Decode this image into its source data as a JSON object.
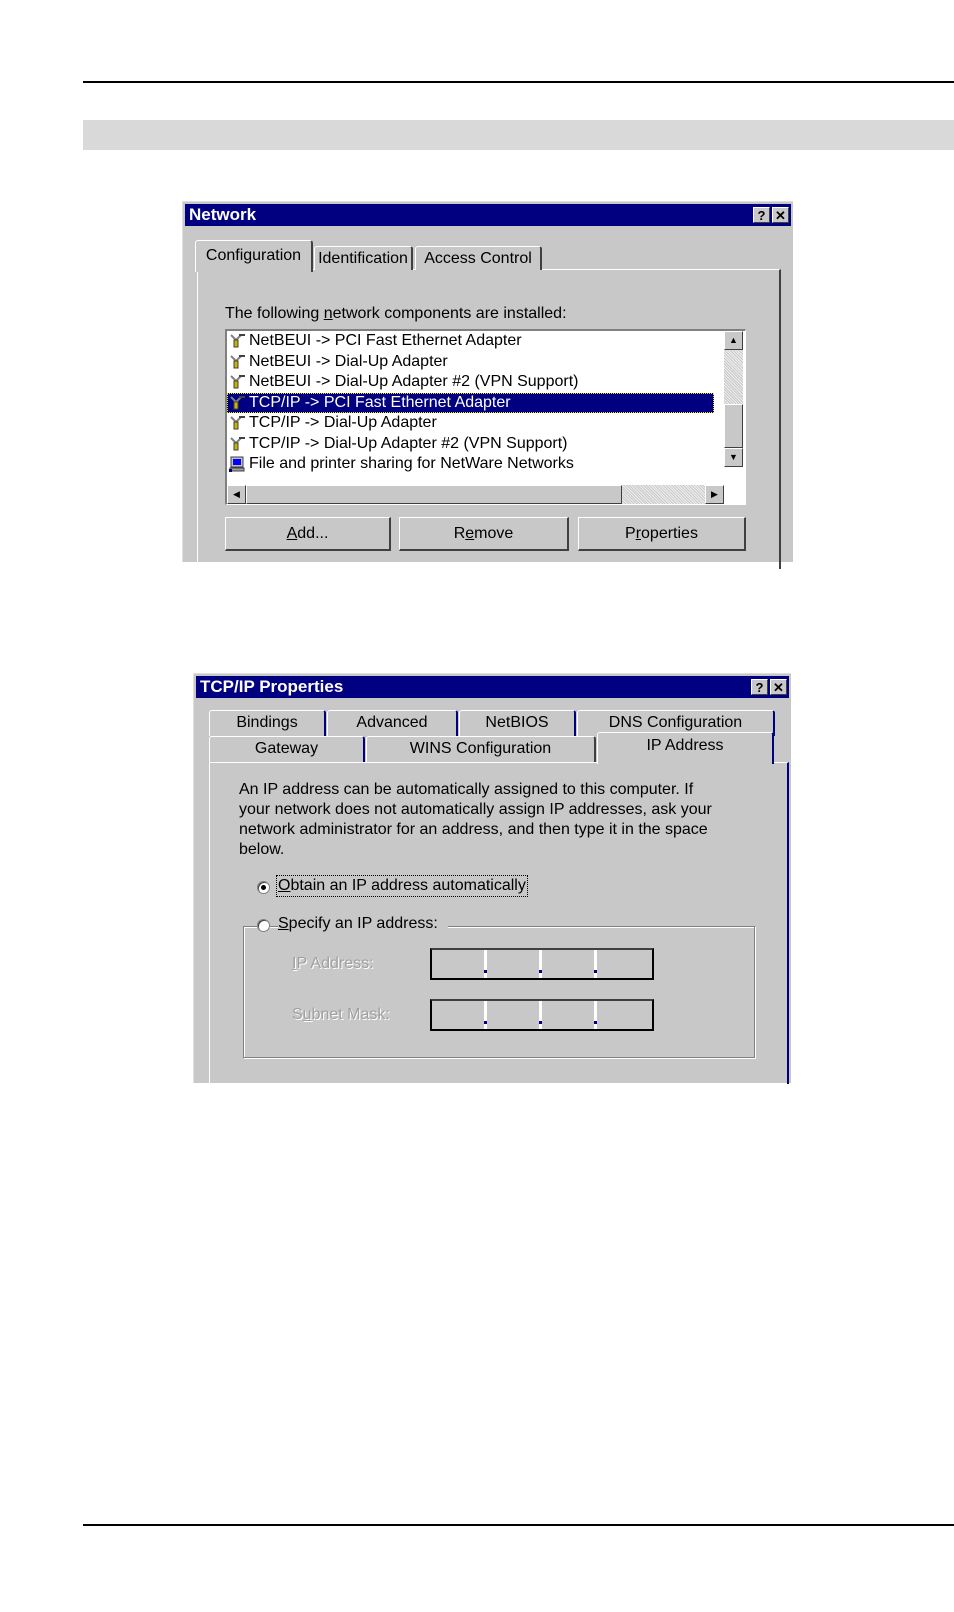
{
  "page": {
    "header_rule": "",
    "section_band": ""
  },
  "network_dialog": {
    "title": "Network",
    "help_button": "?",
    "close_button": "✕",
    "tabs": [
      {
        "label": "Configuration",
        "active": true
      },
      {
        "label": "Identification",
        "active": false
      },
      {
        "label": "Access Control",
        "active": false
      }
    ],
    "components_label_pre": "The following ",
    "components_label_mnemonic": "n",
    "components_label_post": "etwork components are installed:",
    "components": [
      {
        "icon": "protocol-icon",
        "label": "NetBEUI -> PCI Fast Ethernet Adapter",
        "selected": false
      },
      {
        "icon": "protocol-icon",
        "label": "NetBEUI -> Dial-Up Adapter",
        "selected": false
      },
      {
        "icon": "protocol-icon",
        "label": "NetBEUI -> Dial-Up Adapter #2 (VPN Support)",
        "selected": false
      },
      {
        "icon": "protocol-icon",
        "label": "TCP/IP -> PCI Fast Ethernet Adapter",
        "selected": true
      },
      {
        "icon": "protocol-icon",
        "label": "TCP/IP -> Dial-Up Adapter",
        "selected": false
      },
      {
        "icon": "protocol-icon",
        "label": "TCP/IP -> Dial-Up Adapter #2 (VPN Support)",
        "selected": false
      },
      {
        "icon": "service-icon",
        "label": "File and printer sharing for NetWare Networks",
        "selected": false
      }
    ],
    "scroll_up": "▲",
    "scroll_down": "▼",
    "scroll_left": "◀",
    "scroll_right": "▶",
    "buttons": {
      "add": {
        "mnemonic": "A",
        "rest": "dd..."
      },
      "remove": {
        "pre": "R",
        "mnemonic": "e",
        "rest": "move"
      },
      "properties": {
        "pre": "P",
        "mnemonic": "r",
        "rest": "operties"
      }
    }
  },
  "tcpip_dialog": {
    "title": "TCP/IP Properties",
    "help_button": "?",
    "close_button": "✕",
    "tabs_row1": [
      "Bindings",
      "Advanced",
      "NetBIOS",
      "DNS Configuration"
    ],
    "tabs_row2": [
      "Gateway",
      "WINS Configuration",
      "IP Address"
    ],
    "active_tab": "IP Address",
    "description_lines": [
      "An IP address can be automatically assigned to this computer.  If",
      "your network does not automatically assign IP addresses, ask your",
      "network administrator for an address, and then type it in the space",
      "below."
    ],
    "obtain_auto": {
      "mnemonic": "O",
      "rest": "btain an IP address automatically",
      "checked": true
    },
    "specify": {
      "mnemonic": "S",
      "rest": "pecify an IP address:",
      "checked": false
    },
    "ip_address_label": {
      "mnemonic": "I",
      "rest": "P Address:"
    },
    "subnet_mask_label": {
      "pre": "S",
      "mnemonic": "u",
      "rest": "bnet Mask:"
    },
    "ip_address_value": [
      "",
      "",
      "",
      ""
    ],
    "subnet_mask_value": [
      "",
      "",
      "",
      ""
    ]
  },
  "colors": {
    "titlebar": "#000080",
    "dialog_face": "#c8c8c8",
    "selection": "#000080",
    "section_band": "#d9d9d9"
  }
}
